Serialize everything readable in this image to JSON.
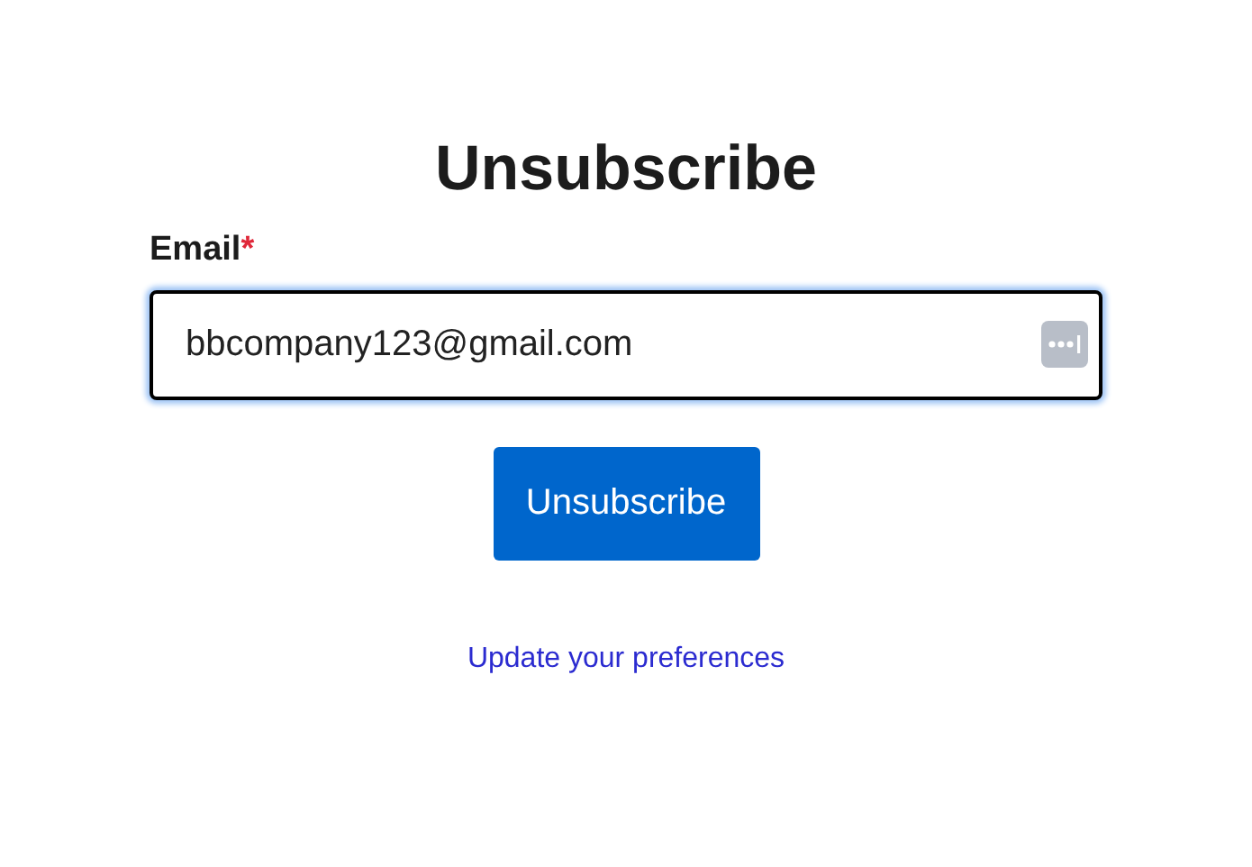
{
  "title": "Unsubscribe",
  "email_field": {
    "label": "Email",
    "required_marker": "*",
    "value": "bbcompany123@gmail.com",
    "focused": true
  },
  "submit_button": {
    "label": "Unsubscribe"
  },
  "preferences_link": {
    "label": "Update your preferences"
  }
}
